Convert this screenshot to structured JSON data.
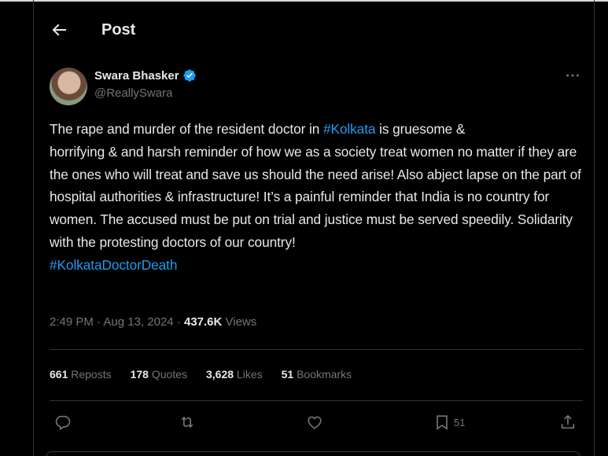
{
  "header": {
    "title": "Post"
  },
  "author": {
    "name": "Swara Bhasker",
    "handle": "@ReallySwara"
  },
  "tweet": {
    "line1_a": "The rape and murder of the resident doctor in ",
    "hashtag1": "#Kolkata",
    "line1_b": " is gruesome &",
    "body": "horrifying & and harsh reminder of how we as a society treat women no matter if they are the ones who will treat and save us should the need arise! Also abject lapse on the part of hospital authorities & infrastructure! It’s a painful reminder that India is no country for women. The accused must be put on trial and justice must be served speedily. Solidarity with the protesting doctors of our country!",
    "hashtag2": "#KolkataDoctorDeath"
  },
  "meta": {
    "time": "2:49 PM",
    "separator": " · ",
    "date": "Aug 13, 2024",
    "views_count": "437.6K",
    "views_label": " Views"
  },
  "stats": {
    "reposts": "661",
    "reposts_label": " Reposts",
    "quotes": "178",
    "quotes_label": " Quotes",
    "likes": "3,628",
    "likes_label": " Likes",
    "bookmarks": "51",
    "bookmarks_label": " Bookmarks"
  },
  "actions": {
    "bookmark_count": "51"
  },
  "icons": [
    "back-arrow-icon",
    "verified-badge-icon",
    "more-icon",
    "reply-icon",
    "repost-icon",
    "like-icon",
    "bookmark-icon",
    "share-icon"
  ],
  "colors": {
    "link": "#1d9bf0",
    "muted": "#71767b",
    "text": "#e7e9ea",
    "background": "#000000"
  }
}
